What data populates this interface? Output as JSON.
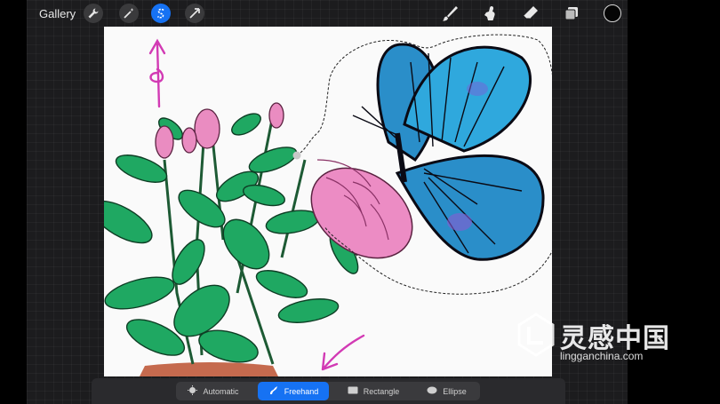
{
  "topbar": {
    "gallery_label": "Gallery",
    "left_tools": [
      "wrench-icon",
      "magic-wand-icon",
      "selection-icon",
      "transform-arrow-icon"
    ],
    "active_tool": "selection-icon",
    "right_tools": [
      "brush-icon",
      "smudge-icon",
      "eraser-icon",
      "layers-icon"
    ],
    "current_color": "#050505"
  },
  "selection_modes": [
    {
      "label": "Automatic",
      "icon": "automatic-icon",
      "active": false
    },
    {
      "label": "Freehand",
      "icon": "freehand-icon",
      "active": true
    },
    {
      "label": "Rectangle",
      "icon": "rectangle-icon",
      "active": false
    },
    {
      "label": "Ellipse",
      "icon": "ellipse-icon",
      "active": false
    }
  ],
  "watermark": {
    "brand": "灵感中国",
    "url": "lingganchina.com"
  },
  "colors": {
    "accent": "#1672f3",
    "annotation": "#d23ab4"
  }
}
